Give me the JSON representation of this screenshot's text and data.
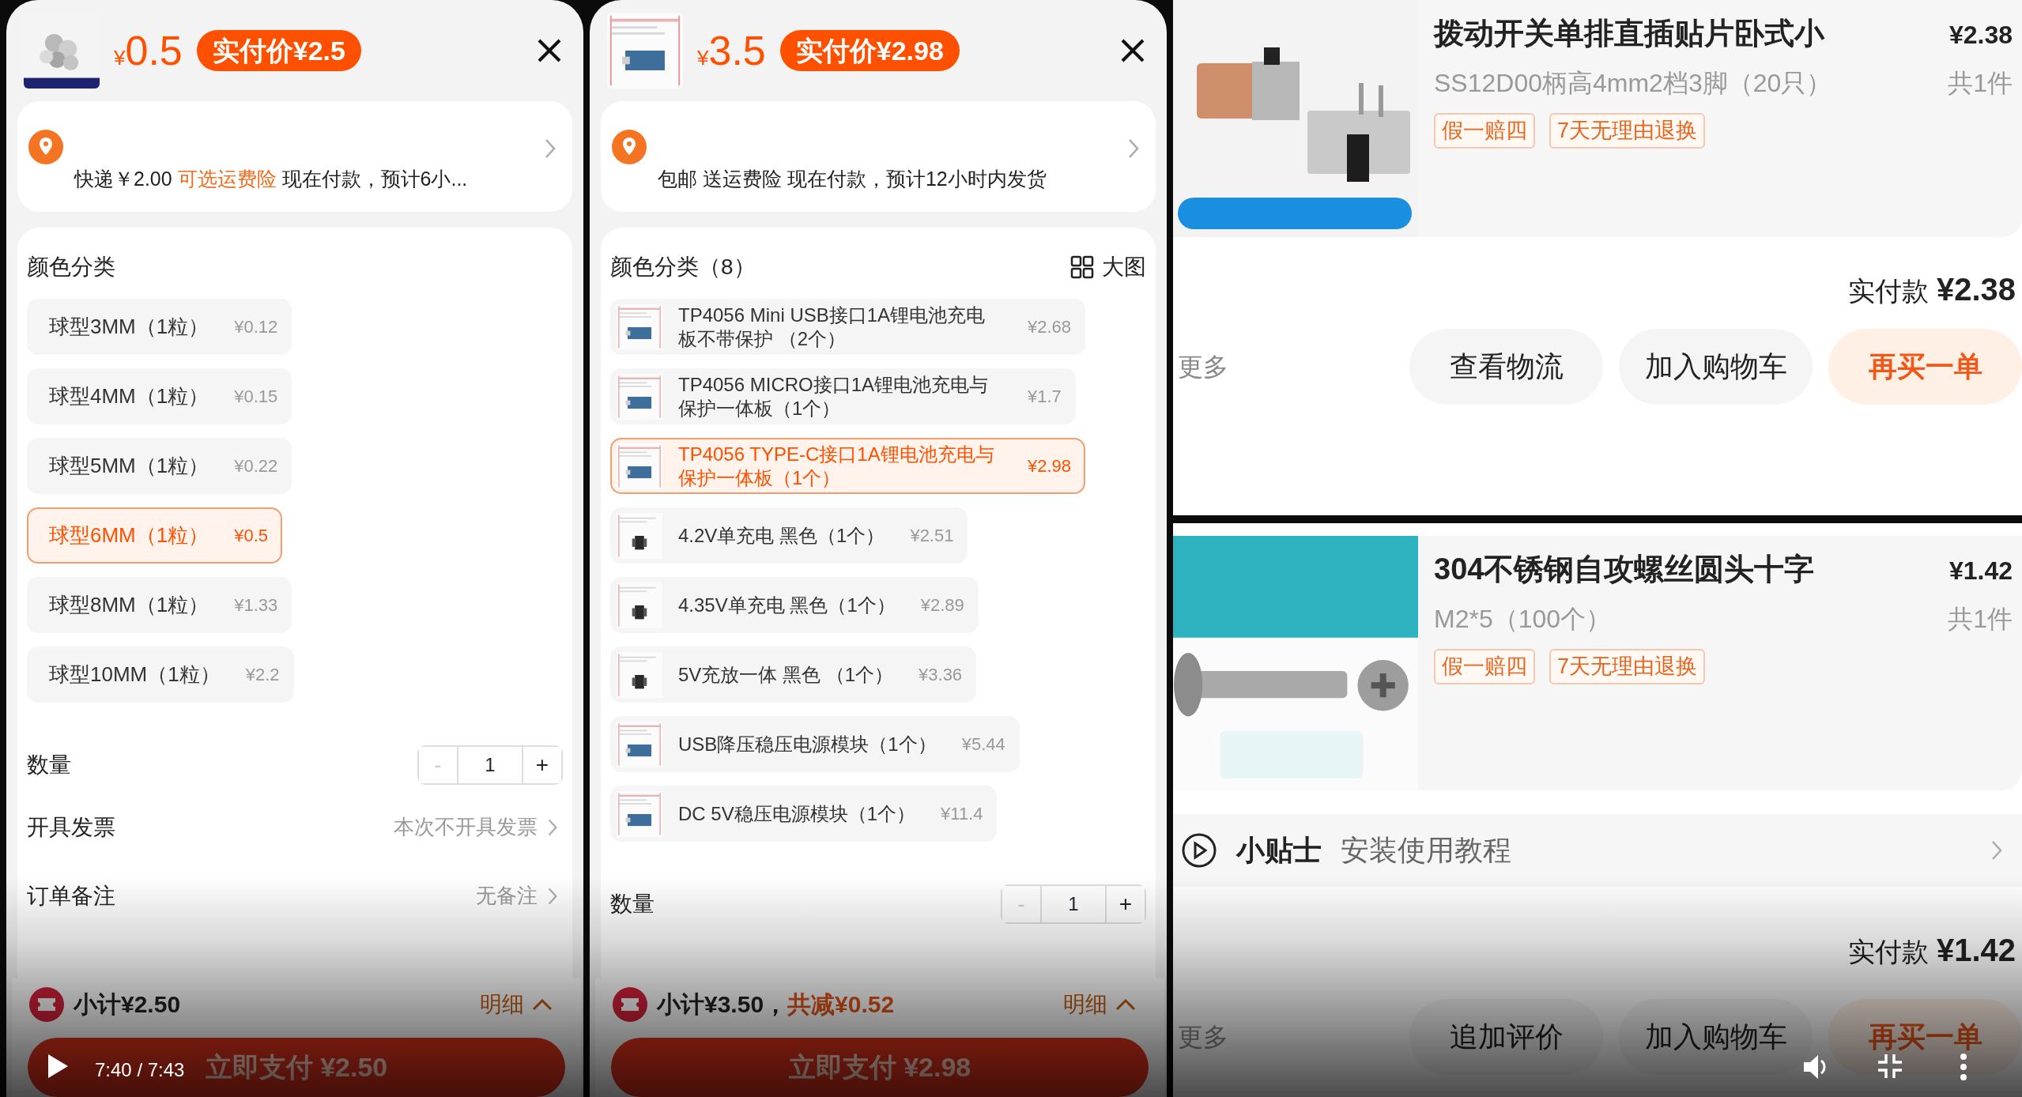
{
  "sheets": [
    {
      "thumbnail": {
        "kind": "picture"
      },
      "currency": "¥",
      "price": "0.5",
      "pay_badge": "实付价¥2.5",
      "shipping": [
        {
          "text": "快递￥2.00 ",
          "highlight": false
        },
        {
          "text": "可选运费险",
          "highlight": true
        },
        {
          "text": " 现在付款，预计6小...",
          "highlight": false
        }
      ],
      "spec_title": "颜色分类",
      "options": [
        {
          "label": "球型3MM（1粒）",
          "price": "¥0.12",
          "selected": false
        },
        {
          "label": "球型4MM（1粒）",
          "price": "¥0.15",
          "selected": false
        },
        {
          "label": "球型5MM（1粒）",
          "price": "¥0.22",
          "selected": false
        },
        {
          "label": "球型6MM（1粒）",
          "price": "¥0.5",
          "selected": true
        },
        {
          "label": "球型8MM（1粒）",
          "price": "¥1.33",
          "selected": false
        },
        {
          "label": "球型10MM（1粒）",
          "price": "¥2.2",
          "selected": false
        }
      ],
      "quantity": {
        "label": "数量",
        "minus": "-",
        "value": "1",
        "plus": "+",
        "minus_disabled": true
      },
      "rows": [
        {
          "label": "开具发票",
          "value": "本次不开具发票"
        },
        {
          "label": "订单备注",
          "value": "无备注"
        }
      ],
      "footer": {
        "subtotal": "小计¥2.50",
        "detail": "明细",
        "pay": "立即支付 ¥2.50"
      }
    },
    {
      "thumbnail": {
        "kind": "picture"
      },
      "currency": "¥",
      "price": "3.5",
      "pay_badge": "实付价¥2.98",
      "shipping": [
        {
          "text": "包邮 送运费险 现在付款，预计12小时内发货",
          "highlight": false
        }
      ],
      "spec_title": "颜色分类（8）",
      "big_view": "大图",
      "options": [
        {
          "thumbnail": {
            "kind": "picture"
          },
          "label": "TP4056 Mini USB接口1A锂电池充电板不带保护 （2个）",
          "price": "¥2.68",
          "selected": false
        },
        {
          "thumbnail": {
            "kind": "picture"
          },
          "label": "TP4056 MICRO接口1A锂电池充电与保护一体板（1个）",
          "price": "¥1.7",
          "selected": false
        },
        {
          "thumbnail": {
            "kind": "picture"
          },
          "label": "TP4056 TYPE-C接口1A锂电池充电与保护一体板（1个）",
          "price": "¥2.98",
          "selected": true
        },
        {
          "thumbnail": {
            "kind": "picture"
          },
          "label": "4.2V单充电 黑色（1个）",
          "price": "¥2.51",
          "selected": false
        },
        {
          "thumbnail": {
            "kind": "picture"
          },
          "label": "4.35V单充电 黑色（1个）",
          "price": "¥2.89",
          "selected": false
        },
        {
          "thumbnail": {
            "kind": "picture"
          },
          "label": "5V充放一体 黑色 （1个）",
          "price": "¥3.36",
          "selected": false
        },
        {
          "thumbnail": {
            "kind": "picture"
          },
          "label": "USB降压稳压电源模块（1个）",
          "price": "¥5.44",
          "selected": false
        },
        {
          "thumbnail": {
            "kind": "picture"
          },
          "label": "DC 5V稳压电源模块（1个）",
          "price": "¥11.4",
          "selected": false
        }
      ],
      "quantity": {
        "label": "数量",
        "minus": "-",
        "value": "1",
        "plus": "+",
        "minus_disabled": true
      },
      "footer": {
        "subtotal": "小计¥3.50，",
        "discount": "共减¥0.52",
        "detail": "明细",
        "pay": "立即支付 ¥2.98"
      }
    }
  ],
  "orders": [
    {
      "thumbnail": {
        "kind": "picture"
      },
      "title": "拨动开关单排直插贴片卧式小",
      "price": "¥2.38",
      "spec": "SS12D00柄高4mm2档3脚（20只）",
      "count": "共1件",
      "tags": [
        "假一赔四",
        "7天无理由退换"
      ],
      "total_label": "实付款",
      "total": "¥2.38",
      "more": "更多",
      "actions": [
        {
          "label": "查看物流",
          "primary": false
        },
        {
          "label": "加入购物车",
          "primary": false
        },
        {
          "label": "再买一单",
          "primary": true
        }
      ]
    },
    {
      "thumbnail": {
        "kind": "picture"
      },
      "title": "304不锈钢自攻螺丝圆头十字",
      "price": "¥1.42",
      "spec": "M2*5（100个）",
      "count": "共1件",
      "tags": [
        "假一赔四",
        "7天无理由退换"
      ],
      "tips": {
        "title": "小贴士",
        "text": "安装使用教程"
      },
      "total_label": "实付款",
      "total": "¥1.42",
      "more": "更多",
      "actions": [
        {
          "label": "追加评价",
          "primary": false
        },
        {
          "label": "加入购物车",
          "primary": false
        },
        {
          "label": "再买一单",
          "primary": true
        }
      ]
    }
  ],
  "player": {
    "time": "7:40 / 7:43"
  }
}
